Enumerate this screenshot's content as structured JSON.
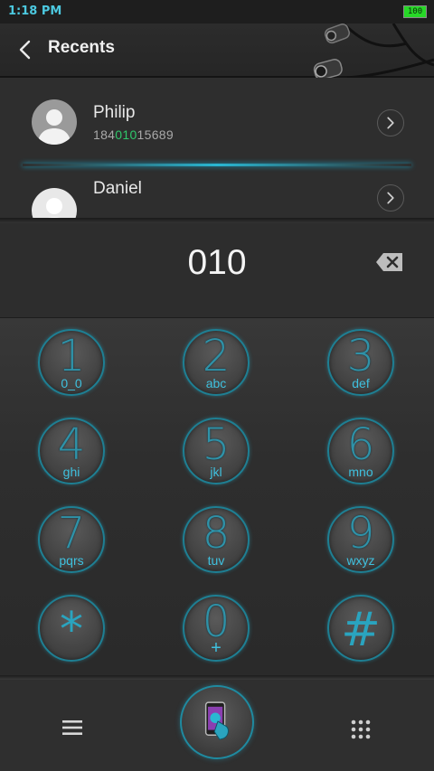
{
  "status": {
    "time": "1:18 PM",
    "battery": "100"
  },
  "header": {
    "title": "Recents"
  },
  "recents": [
    {
      "name": "Philip",
      "number_pre": "184",
      "number_match": "010",
      "number_post": "15689"
    },
    {
      "name": "Daniel"
    }
  ],
  "dialer": {
    "input": "010"
  },
  "keys": [
    {
      "digit": "1",
      "letters": "0_0"
    },
    {
      "digit": "2",
      "letters": "abc"
    },
    {
      "digit": "3",
      "letters": "def"
    },
    {
      "digit": "4",
      "letters": "ghi"
    },
    {
      "digit": "5",
      "letters": "jkl"
    },
    {
      "digit": "6",
      "letters": "mno"
    },
    {
      "digit": "7",
      "letters": "pqrs"
    },
    {
      "digit": "8",
      "letters": "tuv"
    },
    {
      "digit": "9",
      "letters": "wxyz"
    },
    {
      "digit": "*",
      "letters": ""
    },
    {
      "digit": "0",
      "letters": "+"
    },
    {
      "digit": "#",
      "letters": ""
    }
  ],
  "colors": {
    "accent": "#2ab7d2",
    "match": "#2fc76b",
    "battery": "#27d827"
  },
  "icons": [
    "back-arrow-icon",
    "earphones-icon",
    "chevron-right-icon",
    "backspace-icon",
    "menu-icon",
    "call-icon",
    "dialpad-grid-icon"
  ]
}
